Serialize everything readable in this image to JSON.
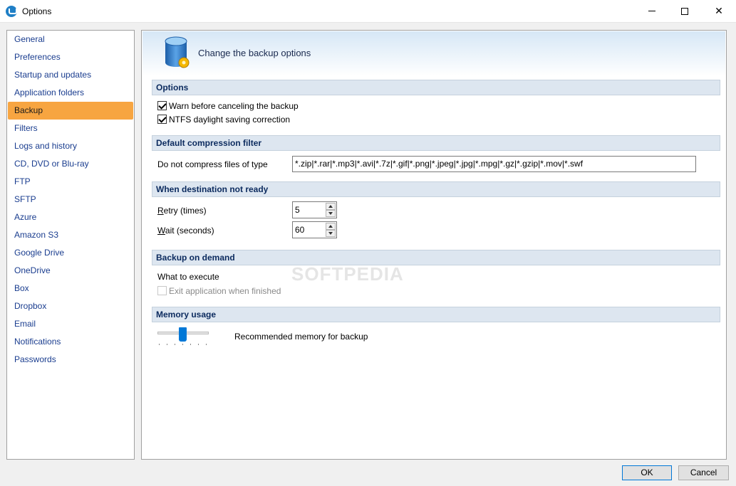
{
  "window": {
    "title": "Options"
  },
  "sidebar": {
    "items": [
      {
        "label": "General",
        "active": false
      },
      {
        "label": "Preferences",
        "active": false
      },
      {
        "label": "Startup and updates",
        "active": false
      },
      {
        "label": "Application folders",
        "active": false
      },
      {
        "label": "Backup",
        "active": true
      },
      {
        "label": "Filters",
        "active": false
      },
      {
        "label": "Logs and history",
        "active": false
      },
      {
        "label": "CD, DVD or Blu-ray",
        "active": false
      },
      {
        "label": "FTP",
        "active": false
      },
      {
        "label": "SFTP",
        "active": false
      },
      {
        "label": "Azure",
        "active": false
      },
      {
        "label": "Amazon S3",
        "active": false
      },
      {
        "label": "Google Drive",
        "active": false
      },
      {
        "label": "OneDrive",
        "active": false
      },
      {
        "label": "Box",
        "active": false
      },
      {
        "label": "Dropbox",
        "active": false
      },
      {
        "label": "Email",
        "active": false
      },
      {
        "label": "Notifications",
        "active": false
      },
      {
        "label": "Passwords",
        "active": false
      }
    ],
    "active_color": "#f7a541"
  },
  "header": {
    "title": "Change the backup options",
    "icon": "database-gear-icon"
  },
  "sections": {
    "options": {
      "title": "Options",
      "warn_label": "Warn before canceling the backup",
      "warn_checked": true,
      "ntfs_label": "NTFS daylight saving correction",
      "ntfs_checked": true
    },
    "compression": {
      "title": "Default compression filter",
      "label": "Do not compress files of type",
      "value": "*.zip|*.rar|*.mp3|*.avi|*.7z|*.gif|*.png|*.jpeg|*.jpg|*.mpg|*.gz|*.gzip|*.mov|*.swf"
    },
    "destination": {
      "title": "When destination not ready",
      "retry_label_first": "R",
      "retry_label_rest": "etry (times)",
      "retry_value": "5",
      "wait_label_first": "W",
      "wait_label_rest": "ait (seconds)",
      "wait_value": "60"
    },
    "demand": {
      "title": "Backup on demand",
      "what_label": "What to execute",
      "exit_label": "Exit application when finished",
      "exit_checked": false,
      "exit_enabled": false
    },
    "memory": {
      "title": "Memory usage",
      "recommended_label": "Recommended memory for backup",
      "slider_level_fraction": 0.5
    }
  },
  "watermark": "SOFTPEDIA",
  "buttons": {
    "ok": "OK",
    "cancel": "Cancel"
  },
  "colors": {
    "accent": "#0078d7",
    "section_bg": "#dde6f0",
    "nav_link": "#1a3d8f"
  }
}
